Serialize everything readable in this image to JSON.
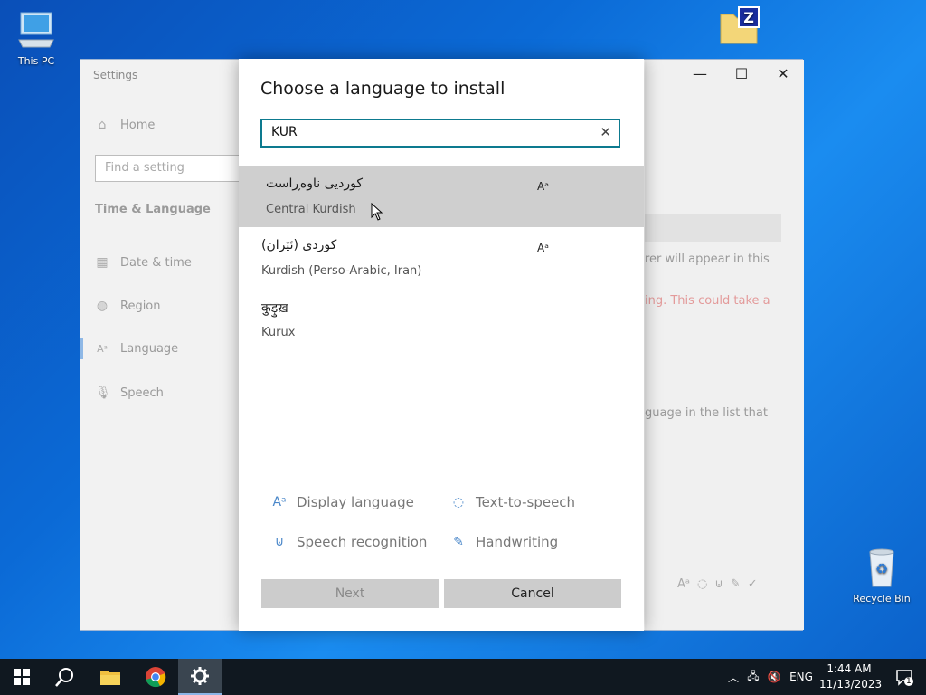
{
  "desktop": {
    "icons": [
      {
        "label": "This PC",
        "icon": "computer-icon"
      },
      {
        "label": "Recycle Bin",
        "icon": "recycle-bin-icon"
      },
      {
        "label": "",
        "icon": "archive-folder-icon"
      }
    ]
  },
  "settings": {
    "app_title": "Settings",
    "home_label": "Home",
    "search_placeholder": "Find a setting",
    "section_title": "Time & Language",
    "nav_items": [
      {
        "label": "Date & time",
        "icon": "calendar-clock-icon"
      },
      {
        "label": "Region",
        "icon": "globe-icon"
      },
      {
        "label": "Language",
        "icon": "language-icon"
      },
      {
        "label": "Speech",
        "icon": "microphone-icon"
      }
    ],
    "pane_text": {
      "line1": "rer will appear in this",
      "line2": "ing. This could take a",
      "line3": "guage in the list that"
    },
    "window_controls": {
      "minimize": "—",
      "maximize": "☐",
      "close": "✕"
    }
  },
  "dialog": {
    "title": "Choose a language to install",
    "search_value": "KUR",
    "languages": [
      {
        "native": "کوردیی ناوەڕاست",
        "english": "Central Kurdish",
        "feature": "display-language-icon"
      },
      {
        "native": "كوردی (ئێران)",
        "english": "Kurdish (Perso-Arabic, Iran)",
        "feature": "display-language-icon"
      },
      {
        "native": "कुड़ुख़",
        "english": "Kurux",
        "feature": ""
      }
    ],
    "features": [
      {
        "label": "Display language",
        "icon": "display-language-icon"
      },
      {
        "label": "Text-to-speech",
        "icon": "text-to-speech-icon"
      },
      {
        "label": "Speech recognition",
        "icon": "microphone-icon"
      },
      {
        "label": "Handwriting",
        "icon": "handwriting-icon"
      }
    ],
    "next_label": "Next",
    "cancel_label": "Cancel"
  },
  "taskbar": {
    "language": "ENG",
    "time": "1:44 AM",
    "date": "11/13/2023",
    "notification_count": "1"
  }
}
